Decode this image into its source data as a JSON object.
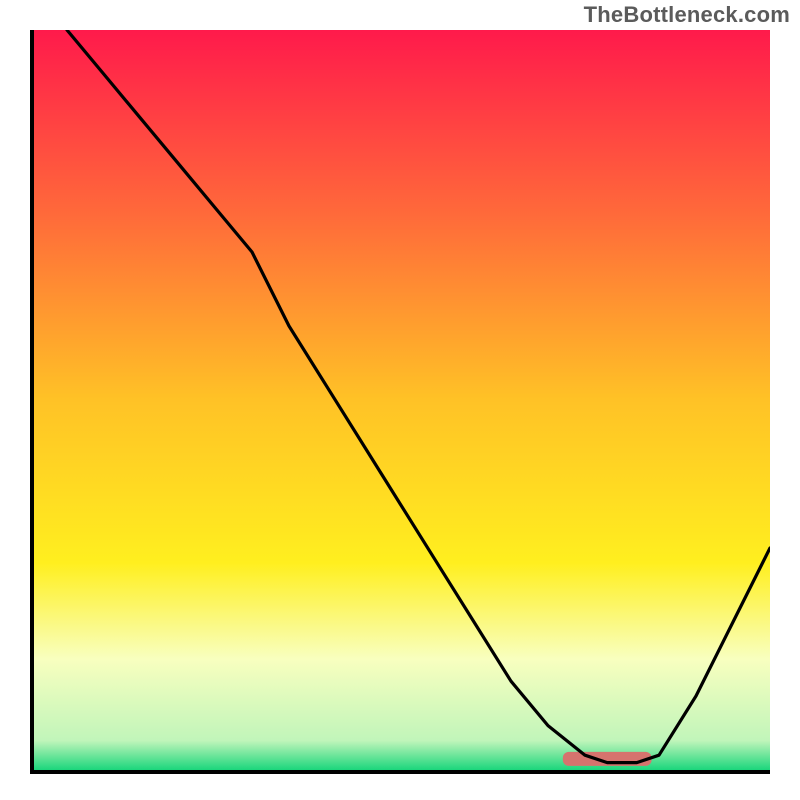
{
  "watermark": "TheBottleneck.com",
  "chart_data": {
    "type": "line",
    "title": "",
    "xlabel": "",
    "ylabel": "",
    "xlim": [
      0,
      100
    ],
    "ylim": [
      0,
      100
    ],
    "gradient_stops": [
      {
        "offset": 0,
        "color": "#ff1a4b"
      },
      {
        "offset": 25,
        "color": "#ff6a3a"
      },
      {
        "offset": 50,
        "color": "#ffc226"
      },
      {
        "offset": 72,
        "color": "#ffef1f"
      },
      {
        "offset": 85,
        "color": "#f8ffbf"
      },
      {
        "offset": 96,
        "color": "#c1f5ba"
      },
      {
        "offset": 100,
        "color": "#1bd67c"
      }
    ],
    "series": [
      {
        "name": "bottleneck-curve",
        "x": [
          5,
          10,
          15,
          20,
          25,
          30,
          35,
          40,
          45,
          50,
          55,
          60,
          65,
          70,
          75,
          78,
          82,
          85,
          90,
          95,
          100
        ],
        "values": [
          100,
          94,
          88,
          82,
          76,
          70,
          60,
          52,
          44,
          36,
          28,
          20,
          12,
          6,
          2,
          1,
          1,
          2,
          10,
          20,
          30
        ]
      }
    ],
    "highlight_bar": {
      "x_start": 72,
      "x_end": 84,
      "y": 1.5,
      "color": "#d6736e"
    }
  }
}
